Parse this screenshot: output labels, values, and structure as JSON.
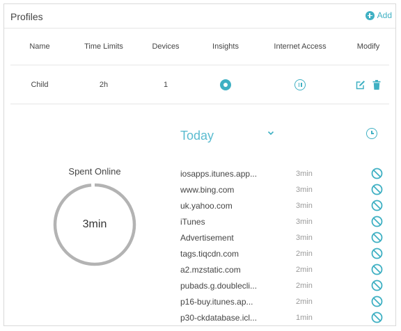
{
  "header": {
    "title": "Profiles",
    "add_label": "Add"
  },
  "columns": [
    "Name",
    "Time Limits",
    "Devices",
    "Insights",
    "Internet Access",
    "Modify"
  ],
  "profile_row": {
    "name": "Child",
    "time_limit": "2h",
    "devices": "1"
  },
  "usage": {
    "period_label": "Today",
    "spent_label": "Spent Online",
    "total": "3min",
    "ring_progress": 0.985,
    "sites": [
      {
        "name": "iosapps.itunes.app...",
        "time": "3min"
      },
      {
        "name": "www.bing.com",
        "time": "3min"
      },
      {
        "name": "uk.yahoo.com",
        "time": "3min"
      },
      {
        "name": "iTunes",
        "time": "3min"
      },
      {
        "name": "Advertisement",
        "time": "3min"
      },
      {
        "name": "tags.tiqcdn.com",
        "time": "2min"
      },
      {
        "name": "a2.mzstatic.com",
        "time": "2min"
      },
      {
        "name": "pubads.g.doublecli...",
        "time": "2min"
      },
      {
        "name": "p16-buy.itunes.ap...",
        "time": "2min"
      },
      {
        "name": "p30-ckdatabase.icl...",
        "time": "1min"
      }
    ]
  },
  "colors": {
    "accent": "#3fb0c3",
    "ring": "#b3b3b3",
    "period": "#5bbcd0"
  },
  "icons": {
    "add": "plus-circle-icon",
    "insights": "eye-icon",
    "internet_access": "pause-icon",
    "edit": "edit-icon",
    "delete": "trash-icon",
    "period": "chevron-down-icon",
    "history": "clock-icon",
    "block": "block-icon"
  }
}
